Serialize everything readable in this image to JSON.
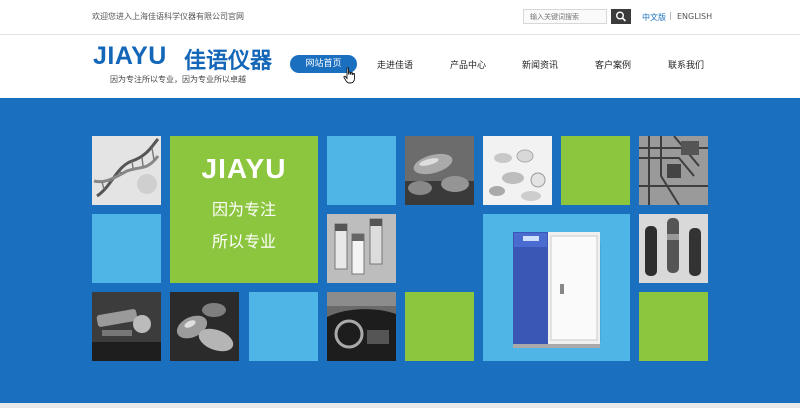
{
  "topbar": {
    "welcome_text": "欢迎您进入上海佳语科学仪器有限公司官网",
    "search_placeholder": "输入关键词搜索",
    "lang_cn": "中文版",
    "lang_sep": "|",
    "lang_en": "ENGLISH"
  },
  "header": {
    "logo_en": "JIAYU",
    "logo_cn": "佳语仪器",
    "slogan": "因为专注所以专业，因为专业所以卓越"
  },
  "nav": {
    "items": [
      {
        "label": "网站首页",
        "active": true
      },
      {
        "label": "走进佳语"
      },
      {
        "label": "产品中心"
      },
      {
        "label": "新闻资讯"
      },
      {
        "label": "客户案例"
      },
      {
        "label": "联系我们"
      }
    ]
  },
  "banner": {
    "brand": "JIAYU",
    "line1": "因为专注",
    "line2": "所以专业"
  },
  "colors": {
    "brand_blue": "#1a6fbf",
    "tile_light_blue": "#4fb4e6",
    "tile_green": "#8cc63e",
    "search_button": "#3b3b3b"
  },
  "icons": {
    "search": "search-icon",
    "cursor": "hand-pointer-icon"
  }
}
